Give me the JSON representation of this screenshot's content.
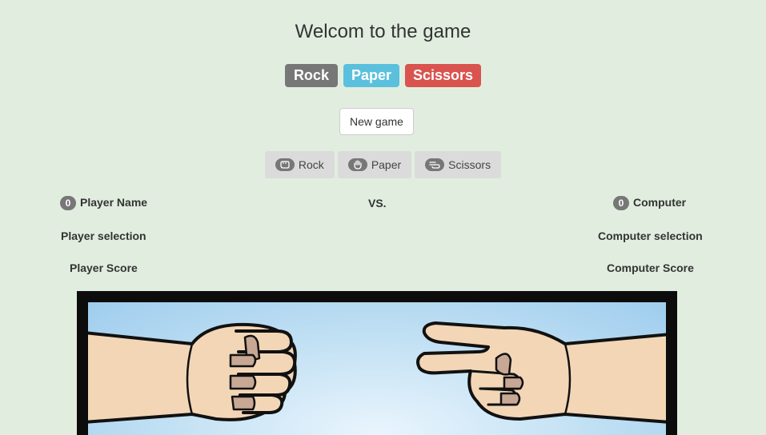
{
  "header": {
    "title": "Welcom to the game"
  },
  "labels": {
    "rock": "Rock",
    "paper": "Paper",
    "scissors": "Scissors"
  },
  "actions": {
    "new_game": "New game"
  },
  "choices": [
    {
      "label": "Rock",
      "icon": "hand-rock-icon"
    },
    {
      "label": "Paper",
      "icon": "hand-paper-icon"
    },
    {
      "label": "Scissors",
      "icon": "hand-scissors-icon"
    }
  ],
  "player": {
    "wins": "0",
    "name": "Player Name",
    "selection": "Player selection",
    "score": "Player Score"
  },
  "versus": "VS.",
  "computer": {
    "wins": "0",
    "name": "Computer",
    "selection": "Computer selection",
    "score": "Computer Score"
  },
  "colors": {
    "background": "#e1eedf",
    "rock": "#777777",
    "paper": "#5bc0de",
    "scissors": "#d9534f"
  }
}
